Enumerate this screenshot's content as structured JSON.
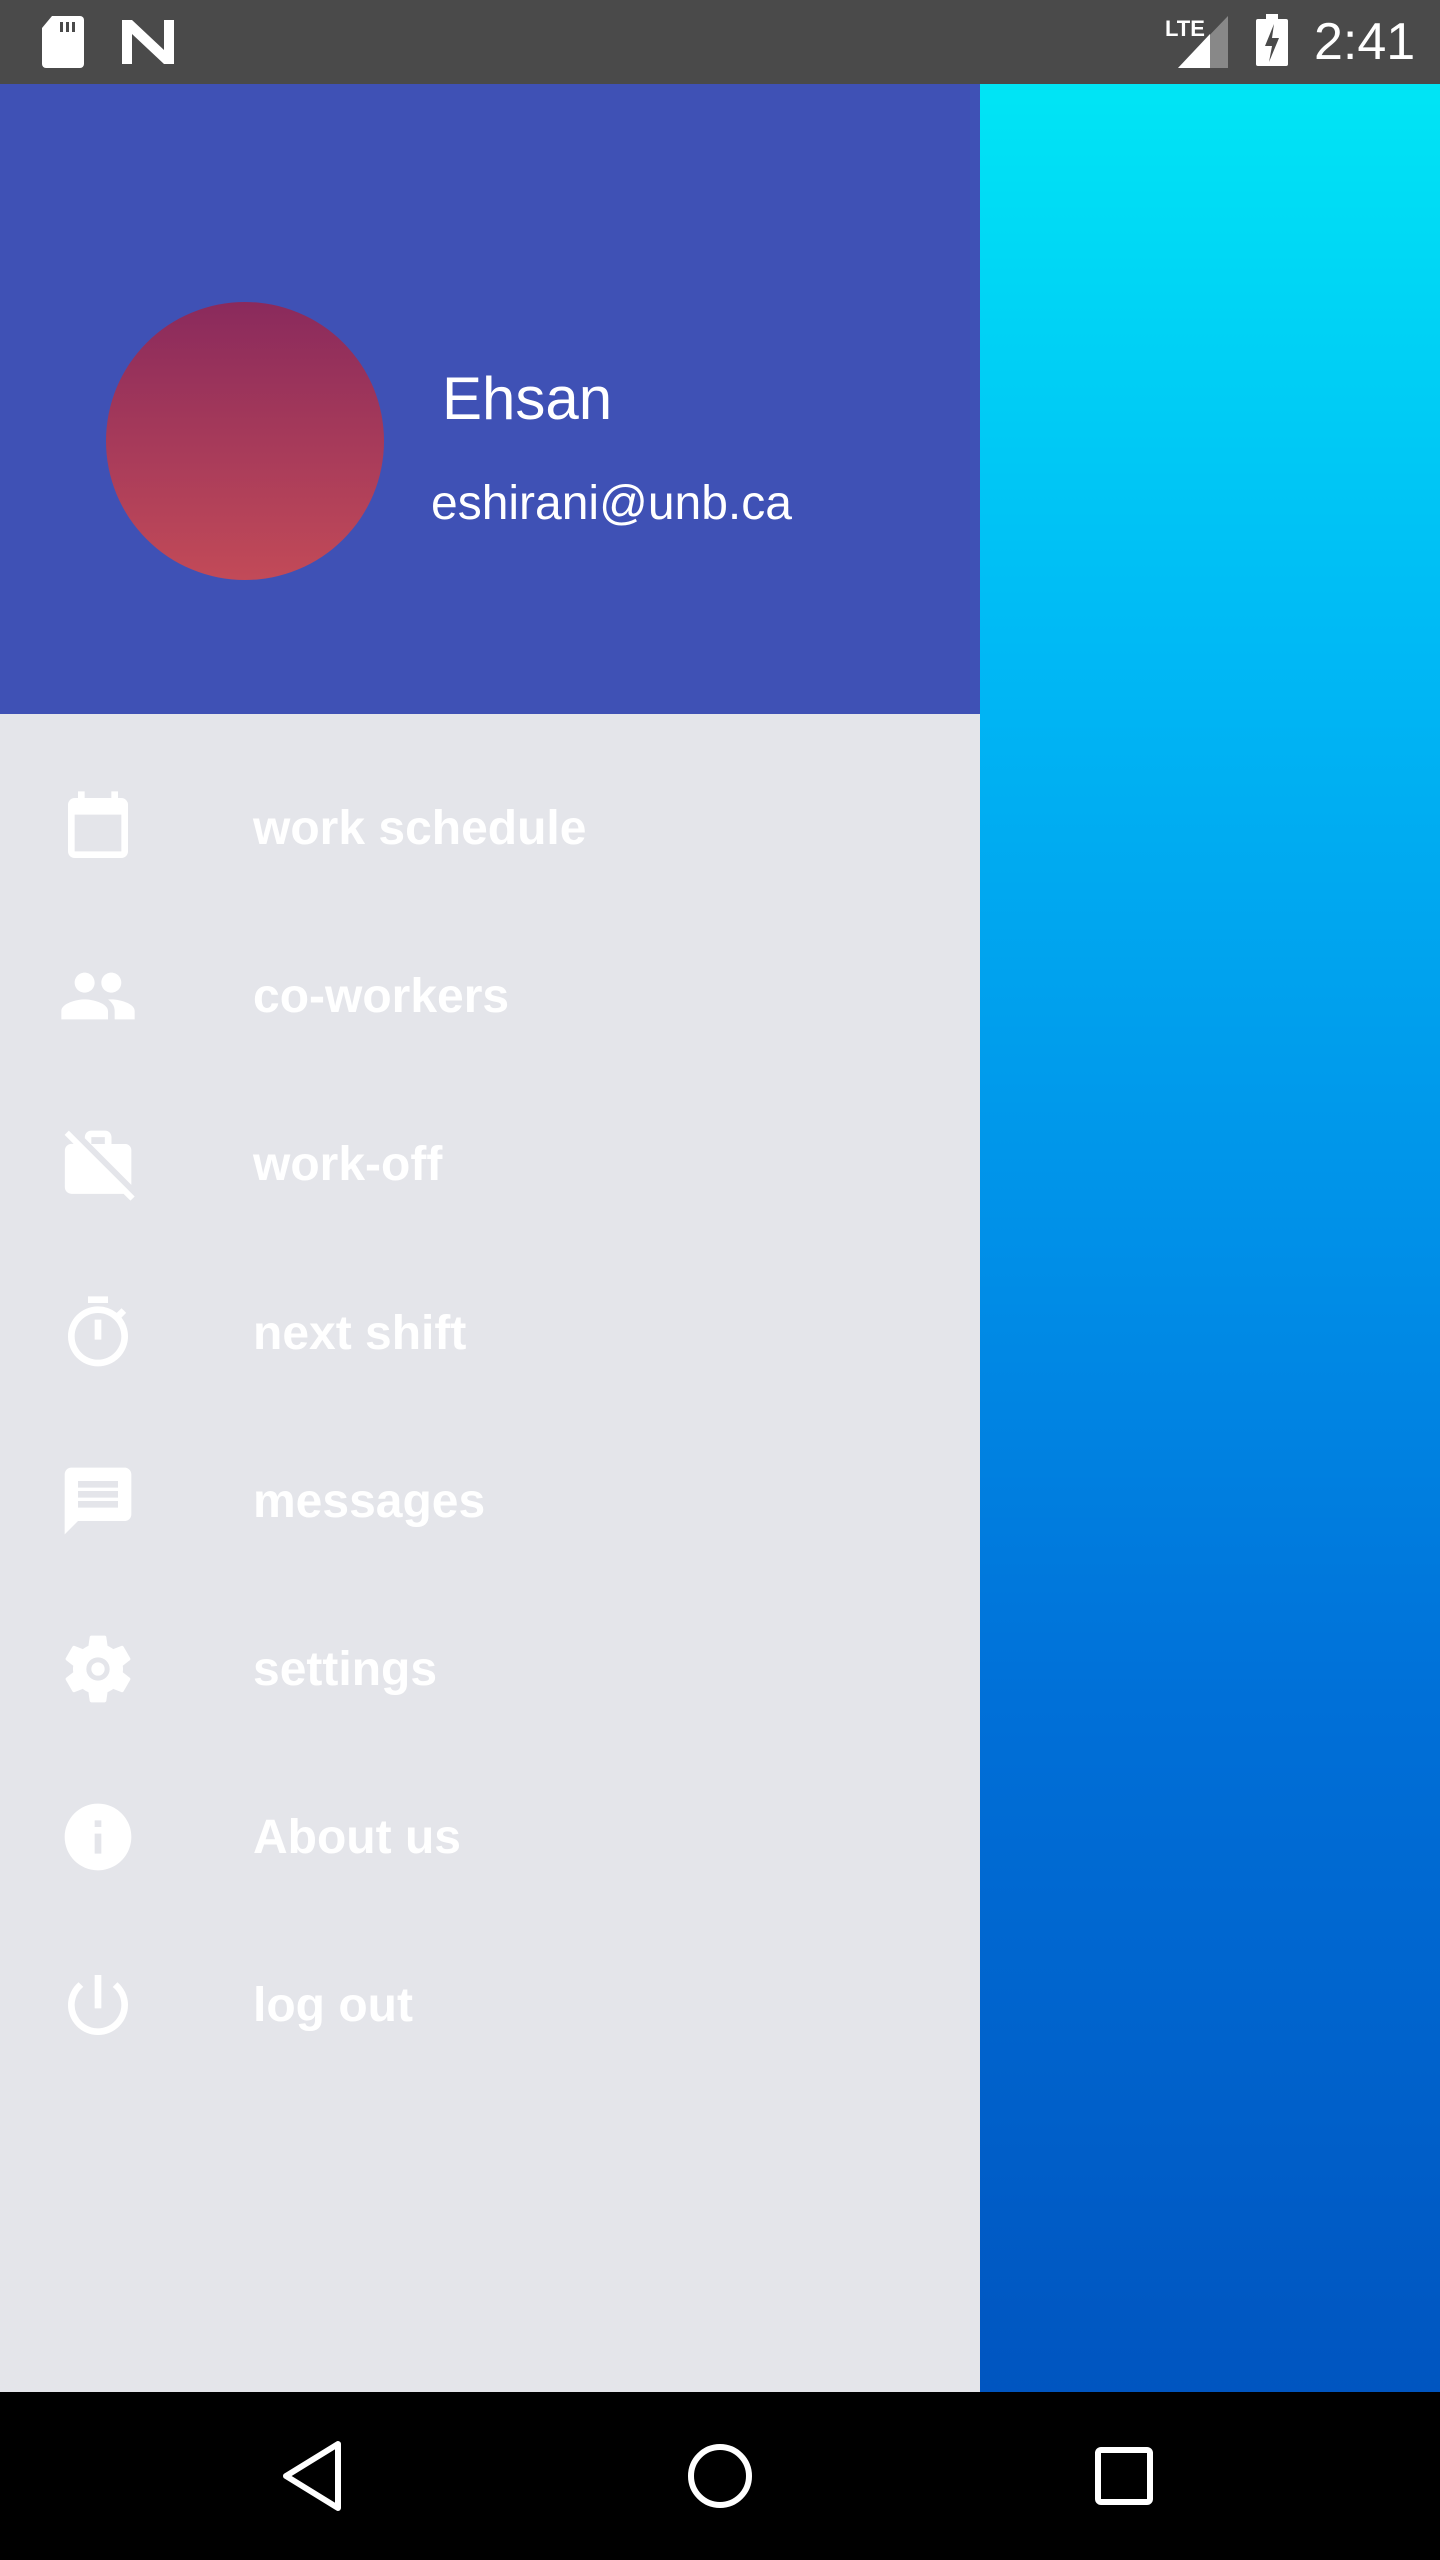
{
  "status_bar": {
    "time": "2:41",
    "network": "LTE",
    "icons": [
      "sd-card-icon",
      "n-icon",
      "signal-icon",
      "battery-charging-icon"
    ]
  },
  "drawer": {
    "user": {
      "name": "Ehsan",
      "email": "eshirani@unb.ca"
    },
    "items": [
      {
        "label": "work schedule",
        "icon": "calendar-icon"
      },
      {
        "label": "co-workers",
        "icon": "people-icon"
      },
      {
        "label": "work-off",
        "icon": "work-off-icon"
      },
      {
        "label": "next shift",
        "icon": "timer-icon"
      },
      {
        "label": "messages",
        "icon": "message-icon"
      },
      {
        "label": "settings",
        "icon": "gear-icon"
      },
      {
        "label": "About us",
        "icon": "info-icon"
      },
      {
        "label": "log out",
        "icon": "power-icon"
      }
    ]
  },
  "colors": {
    "header": "#3f51b5",
    "drawer_bg": "#e4e5ea",
    "status_bar": "#4a4a4a"
  }
}
